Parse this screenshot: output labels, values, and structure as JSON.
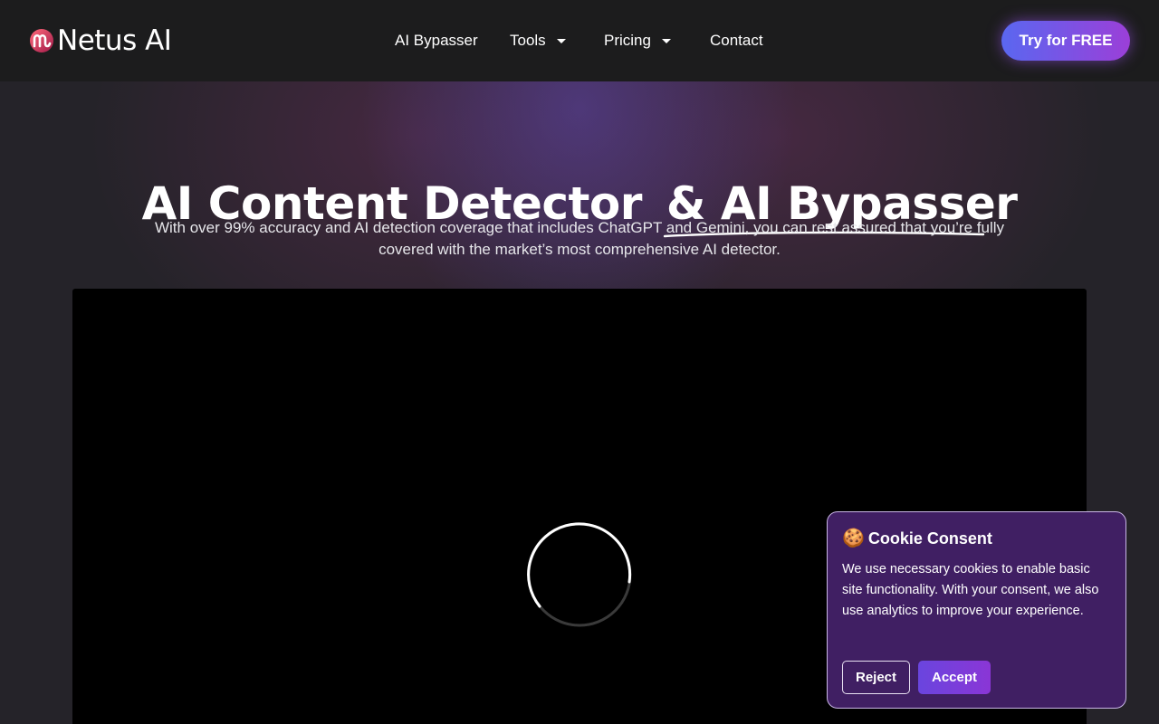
{
  "nav": {
    "logo_text": "Netus AI",
    "items": [
      {
        "label": "AI Bypasser",
        "has_dropdown": false
      },
      {
        "label": "Tools",
        "has_dropdown": true
      },
      {
        "label": "Pricing",
        "has_dropdown": true
      },
      {
        "label": "Contact",
        "has_dropdown": false
      }
    ],
    "cta_label": "Try for FREE"
  },
  "hero": {
    "title_part1": "AI Content Detector",
    "title_part2": "& AI Bypasser",
    "subtitle_line1": "With over 99% accuracy and AI detection coverage that includes ChatGPT and Gemini, you can rest assured that you’re fully",
    "subtitle_line2": "covered with the market’s most comprehensive AI detector."
  },
  "video": {
    "state": "loading",
    "icon": "loading-spinner-icon"
  },
  "cookie": {
    "emoji": "🍪",
    "title": "Cookie Consent",
    "text": "We use necessary cookies to enable basic site functionality. With your consent, we also use analytics to improve your experience.",
    "reject_label": "Reject",
    "accept_label": "Accept"
  },
  "colors": {
    "nav_bg": "#1c1c1d",
    "page_bg": "#252329",
    "cta_gradient_start": "#5a67f0",
    "cta_gradient_end": "#9b3fd8",
    "cookie_bg": "#401f63",
    "accept_gradient_start": "#6a45de",
    "accept_gradient_end": "#8a36d6"
  }
}
